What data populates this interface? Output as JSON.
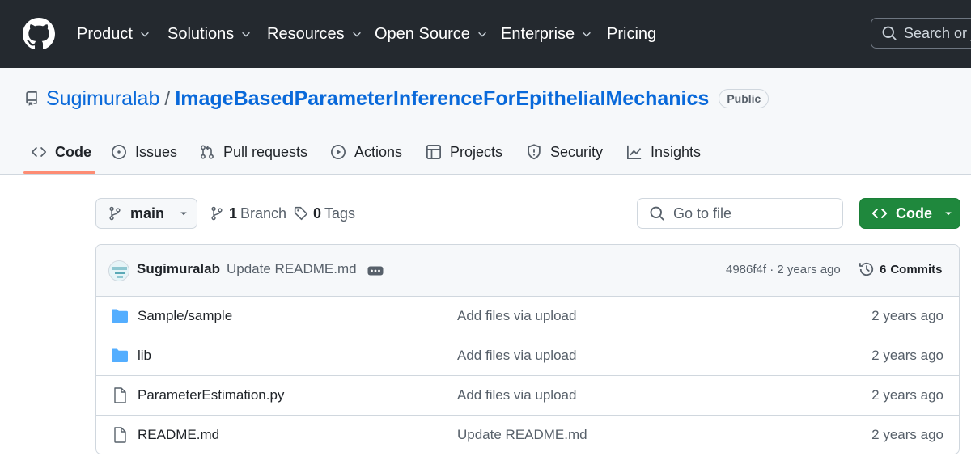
{
  "colors": {
    "header_bg": "#24292f",
    "link_blue": "#0969da",
    "code_button_green": "#1f883d",
    "active_tab_underline": "#fd8c73",
    "folder_blue": "#54aeff"
  },
  "header": {
    "logo": "github-logo-icon",
    "nav": [
      {
        "label": "Product",
        "has_dropdown": true
      },
      {
        "label": "Solutions",
        "has_dropdown": true
      },
      {
        "label": "Resources",
        "has_dropdown": true
      },
      {
        "label": "Open Source",
        "has_dropdown": true
      },
      {
        "label": "Enterprise",
        "has_dropdown": true
      },
      {
        "label": "Pricing",
        "has_dropdown": false
      }
    ],
    "search_placeholder": "Search or ju"
  },
  "repo": {
    "owner": "Sugimuralab",
    "separator": "/",
    "name": "ImageBasedParameterInferenceForEpithelialMechanics",
    "visibility": "Public"
  },
  "tabs": [
    {
      "label": "Code",
      "icon": "code-icon",
      "active": true
    },
    {
      "label": "Issues",
      "icon": "issue-opened-icon",
      "active": false
    },
    {
      "label": "Pull requests",
      "icon": "git-pull-request-icon",
      "active": false
    },
    {
      "label": "Actions",
      "icon": "play-icon",
      "active": false
    },
    {
      "label": "Projects",
      "icon": "table-icon",
      "active": false
    },
    {
      "label": "Security",
      "icon": "shield-icon",
      "active": false
    },
    {
      "label": "Insights",
      "icon": "graph-icon",
      "active": false
    }
  ],
  "controls": {
    "branch": "main",
    "branch_count": "1",
    "branch_label": "Branch",
    "tag_count": "0",
    "tag_label": "Tags",
    "go_to_file_placeholder": "Go to file",
    "code_button": "Code"
  },
  "latest_commit": {
    "author": "Sugimuralab",
    "message": "Update README.md",
    "hash_and_time": "4986f4f · 2 years ago",
    "commits_count": "6",
    "commits_label": "Commits"
  },
  "files": [
    {
      "type": "folder",
      "name": "Sample/sample",
      "message": "Add files via upload",
      "time": "2 years ago"
    },
    {
      "type": "folder",
      "name": "lib",
      "message": "Add files via upload",
      "time": "2 years ago"
    },
    {
      "type": "file",
      "name": "ParameterEstimation.py",
      "message": "Add files via upload",
      "time": "2 years ago"
    },
    {
      "type": "file",
      "name": "README.md",
      "message": "Update README.md",
      "time": "2 years ago"
    }
  ]
}
